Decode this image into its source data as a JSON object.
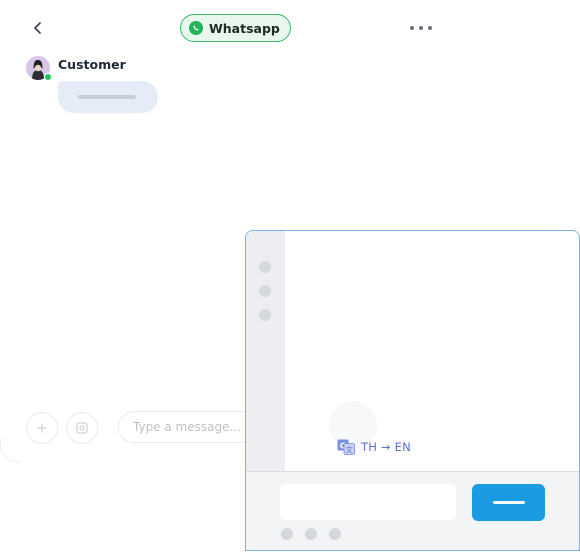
{
  "header": {
    "channel_label": "Whatsapp",
    "icons": {
      "back": "chevron-left-icon",
      "channel": "whatsapp-icon",
      "more": "more-horizontal-icon"
    }
  },
  "conversation": {
    "customer_name": "Customer",
    "status": "online"
  },
  "composer": {
    "placeholder": "Type a message..."
  },
  "translation": {
    "label": "TH → EN",
    "icon": "translate-icon"
  },
  "colors": {
    "channel_border": "#43b56b",
    "channel_bg": "#e8f7ee",
    "online": "#22c55e",
    "send_button": "#1a9be3",
    "panel_border": "#7fb0e6",
    "translate_text": "#5d6fd1"
  }
}
